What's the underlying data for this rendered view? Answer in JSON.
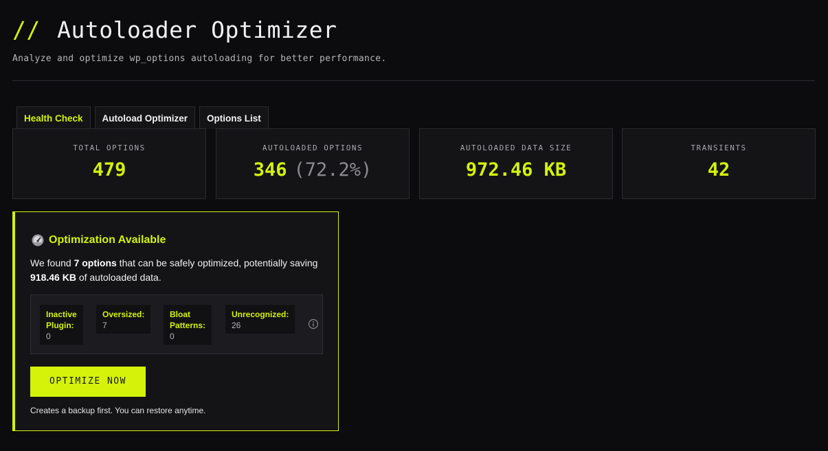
{
  "header": {
    "title_prefix": "//",
    "title": "Autoloader Optimizer",
    "subtitle": "Analyze and optimize wp_options autoloading for better performance."
  },
  "tabs": [
    {
      "label": "Health Check",
      "active": true
    },
    {
      "label": "Autoload Optimizer",
      "active": false
    },
    {
      "label": "Options List",
      "active": false
    }
  ],
  "stats": [
    {
      "label": "TOTAL OPTIONS",
      "value": "479"
    },
    {
      "label": "AUTOLOADED OPTIONS",
      "value": "346",
      "extra": "(72.2%)"
    },
    {
      "label": "AUTOLOADED DATA SIZE",
      "value": "972.46 KB"
    },
    {
      "label": "TRANSIENTS",
      "value": "42"
    }
  ],
  "optimization": {
    "title": "Optimization Available",
    "icon": "gauge-icon",
    "text_before": "We found ",
    "options_count": "7 options",
    "text_middle": " that can be safely optimized, potentially saving ",
    "savings": "918.46 KB",
    "text_after": " of autoloaded data.",
    "breakdown": [
      {
        "label_lines": [
          "Inactive",
          "Plugin:"
        ],
        "value": "0"
      },
      {
        "label_lines": [
          "Oversized:"
        ],
        "value": "7"
      },
      {
        "label_lines": [
          "Bloat",
          "Patterns:"
        ],
        "value": "0"
      },
      {
        "label_lines": [
          "Unrecognized:"
        ],
        "value": "26"
      }
    ],
    "button_label": "OPTIMIZE NOW",
    "backup_note": "Creates a backup first. You can restore anytime."
  },
  "colors": {
    "accent": "#d4f20a",
    "background": "#0c0b0e",
    "card": "#141417"
  }
}
